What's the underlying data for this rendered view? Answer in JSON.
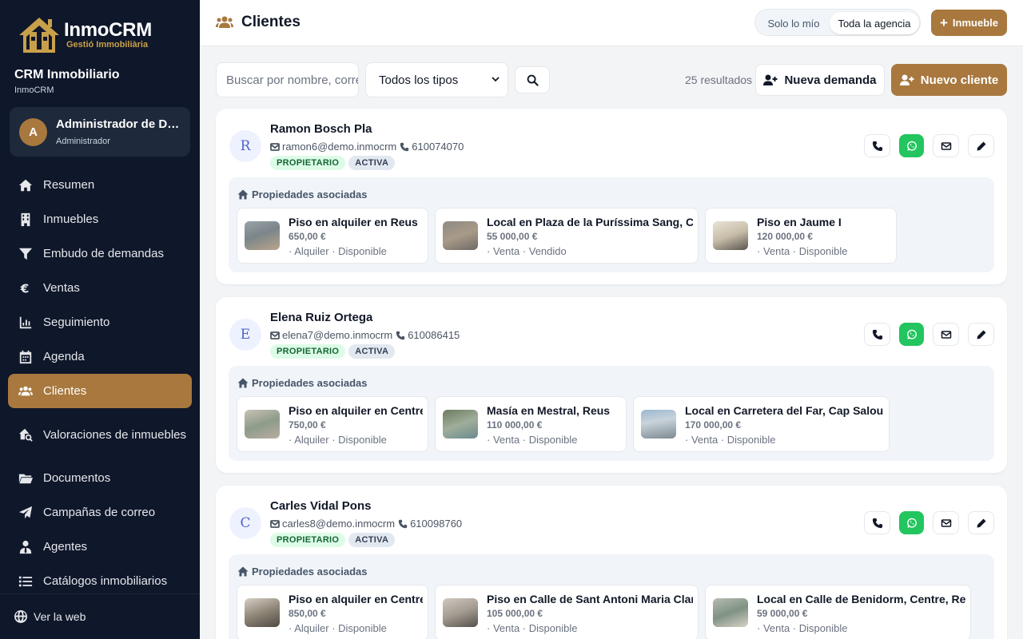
{
  "brand": {
    "name": "InmoCRM",
    "tagline": "Gestió Immobiliària"
  },
  "sidebar": {
    "crm_title": "CRM Inmobiliario",
    "crm_sub": "InmoCRM",
    "user": {
      "initial": "A",
      "name": "Administrador de Demo",
      "role": "Administrador"
    },
    "items": [
      {
        "label": "Resumen",
        "icon": "home-icon"
      },
      {
        "label": "Inmuebles",
        "icon": "building-icon"
      },
      {
        "label": "Embudo de demandas",
        "icon": "funnel-icon"
      },
      {
        "label": "Ventas",
        "icon": "euro-icon"
      },
      {
        "label": "Seguimiento",
        "icon": "chart-icon"
      },
      {
        "label": "Agenda",
        "icon": "calendar-icon"
      },
      {
        "label": "Clientes",
        "icon": "users-icon",
        "active": true
      },
      {
        "label": "Valoraciones de inmuebles",
        "icon": "house-search-icon"
      },
      {
        "label": "Documentos",
        "icon": "folder-icon"
      },
      {
        "label": "Campañas de correo",
        "icon": "paper-plane-icon"
      },
      {
        "label": "Agentes",
        "icon": "user-tie-icon"
      },
      {
        "label": "Catálogos inmobiliarios",
        "icon": "list-icon"
      }
    ],
    "footer_link": "Ver la web"
  },
  "topbar": {
    "title": "Clientes",
    "scope_mine": "Solo lo mío",
    "scope_all": "Toda la agencia",
    "add_property": "Inmueble"
  },
  "filters": {
    "search_placeholder": "Buscar por nombre, correo o teléfono",
    "type_selected": "Todos los tipos",
    "results": "25 resultados",
    "new_demand": "Nueva demanda",
    "new_client": "Nuevo cliente"
  },
  "labels": {
    "associated": "Propiedades asociadas"
  },
  "clients": [
    {
      "initial": "R",
      "name": "Ramon Bosch Pla",
      "email": "ramon6@demo.inmocrm",
      "phone": "610074070",
      "tags": [
        "PROPIETARIO",
        "ACTIVA"
      ],
      "properties": [
        {
          "title": "Piso en alquiler en Reus",
          "price": "650,00 €",
          "meta": "· Alquiler · Disponible"
        },
        {
          "title": "Local en Plaza de la Puríssima Sang, Centre",
          "price": "55 000,00 €",
          "meta": "· Venta · Vendido"
        },
        {
          "title": "Piso en Jaume I",
          "price": "120 000,00 €",
          "meta": "· Venta · Disponible"
        }
      ]
    },
    {
      "initial": "E",
      "name": "Elena Ruiz Ortega",
      "email": "elena7@demo.inmocrm",
      "phone": "610086415",
      "tags": [
        "PROPIETARIO",
        "ACTIVA"
      ],
      "properties": [
        {
          "title": "Piso en alquiler en Centre",
          "price": "750,00 €",
          "meta": "· Alquiler · Disponible"
        },
        {
          "title": "Masía en Mestral, Reus",
          "price": "110 000,00 €",
          "meta": "· Venta · Disponible"
        },
        {
          "title": "Local en Carretera del Far, Cap Salou, Salou",
          "price": "170 000,00 €",
          "meta": "· Venta · Disponible"
        }
      ]
    },
    {
      "initial": "C",
      "name": "Carles Vidal Pons",
      "email": "carles8@demo.inmocrm",
      "phone": "610098760",
      "tags": [
        "PROPIETARIO",
        "ACTIVA"
      ],
      "properties": [
        {
          "title": "Piso en alquiler en Centre",
          "price": "850,00 €",
          "meta": "· Alquiler · Disponible"
        },
        {
          "title": "Piso en Calle de Sant Antoni Maria Claret, Reus",
          "price": "105 000,00 €",
          "meta": "· Venta · Disponible"
        },
        {
          "title": "Local en Calle de Benidorm, Centre, Reus",
          "price": "59 000,00 €",
          "meta": "· Venta · Disponible"
        }
      ]
    }
  ],
  "colors": {
    "accent": "#a8783e",
    "sidebar_bg": "#0f172a",
    "whatsapp": "#22c55e"
  }
}
